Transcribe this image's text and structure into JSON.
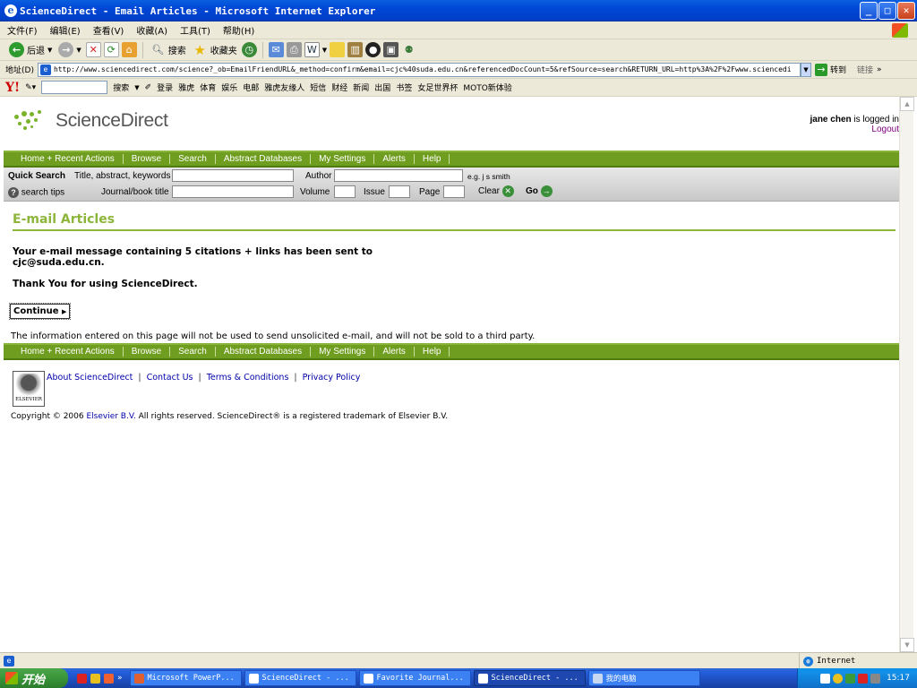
{
  "window": {
    "title": "ScienceDirect - Email Articles - Microsoft Internet Explorer"
  },
  "menu": [
    "文件(F)",
    "编辑(E)",
    "查看(V)",
    "收藏(A)",
    "工具(T)",
    "帮助(H)"
  ],
  "toolbar": {
    "back": "后退",
    "search": "搜索",
    "favorites": "收藏夹"
  },
  "address": {
    "label": "地址(D)",
    "url": "http://www.sciencedirect.com/science?_ob=EmailFriendURL&_method=confirm&email=cjc%40suda.edu.cn&referencedDocCount=5&refSource=search&RETURN_URL=http%3A%2F%2Fwww.sciencedi",
    "go": "转到",
    "links": "链接"
  },
  "yahoo": {
    "search": "搜索",
    "login": "登录",
    "items": [
      "雅虎",
      "体育",
      "娱乐",
      "电邮",
      "雅虎友缘人",
      "短信",
      "财经",
      "新闻",
      "出国",
      "书签",
      "女足世界杯",
      "MOTO新体验"
    ]
  },
  "site": {
    "logo": "ScienceDirect",
    "user": "jane chen",
    "logged_suffix": " is logged in",
    "logout": "Logout",
    "nav": [
      "Home + Recent Actions",
      "Browse",
      "Search",
      "Abstract Databases",
      "My Settings",
      "Alerts",
      "Help"
    ]
  },
  "quicksearch": {
    "title": "Quick Search",
    "label_title": "Title, abstract, keywords",
    "label_author": "Author",
    "author_hint": "e.g. j s smith",
    "search_tips": "search tips",
    "label_journal": "Journal/book title",
    "label_volume": "Volume",
    "label_issue": "Issue",
    "label_page": "Page",
    "clear": "Clear",
    "go": "Go"
  },
  "main": {
    "title": "E-mail Articles",
    "msg1": "Your e-mail message containing 5 citations + links has been sent to",
    "msg2": "cjc@suda.edu.cn.",
    "thanks": "Thank You for using ScienceDirect.",
    "continue": "Continue",
    "notice": "The information entered on this page will not be used to send unsolicited e-mail, and will not be sold to a third party."
  },
  "footer": {
    "links": [
      "About ScienceDirect",
      "Contact Us",
      "Terms & Conditions",
      "Privacy Policy"
    ],
    "elsevier_logo": "ELSEVIER",
    "copyright_pre": "Copyright © 2006 ",
    "copyright_link": "Elsevier B.V.",
    "copyright_post": " All rights reserved. ScienceDirect® is a registered trademark of Elsevier B.V."
  },
  "status": {
    "zone": "Internet"
  },
  "taskbar": {
    "start": "开始",
    "buttons": [
      "Microsoft PowerP...",
      "ScienceDirect - ...",
      "Favorite Journal...",
      "ScienceDirect - ...",
      "我的电脑"
    ],
    "active_index": 3,
    "clock": "15:17"
  },
  "colors": {
    "accent": "#8cb53a",
    "nav": "#6f9d1f",
    "link": "#0000aa"
  }
}
